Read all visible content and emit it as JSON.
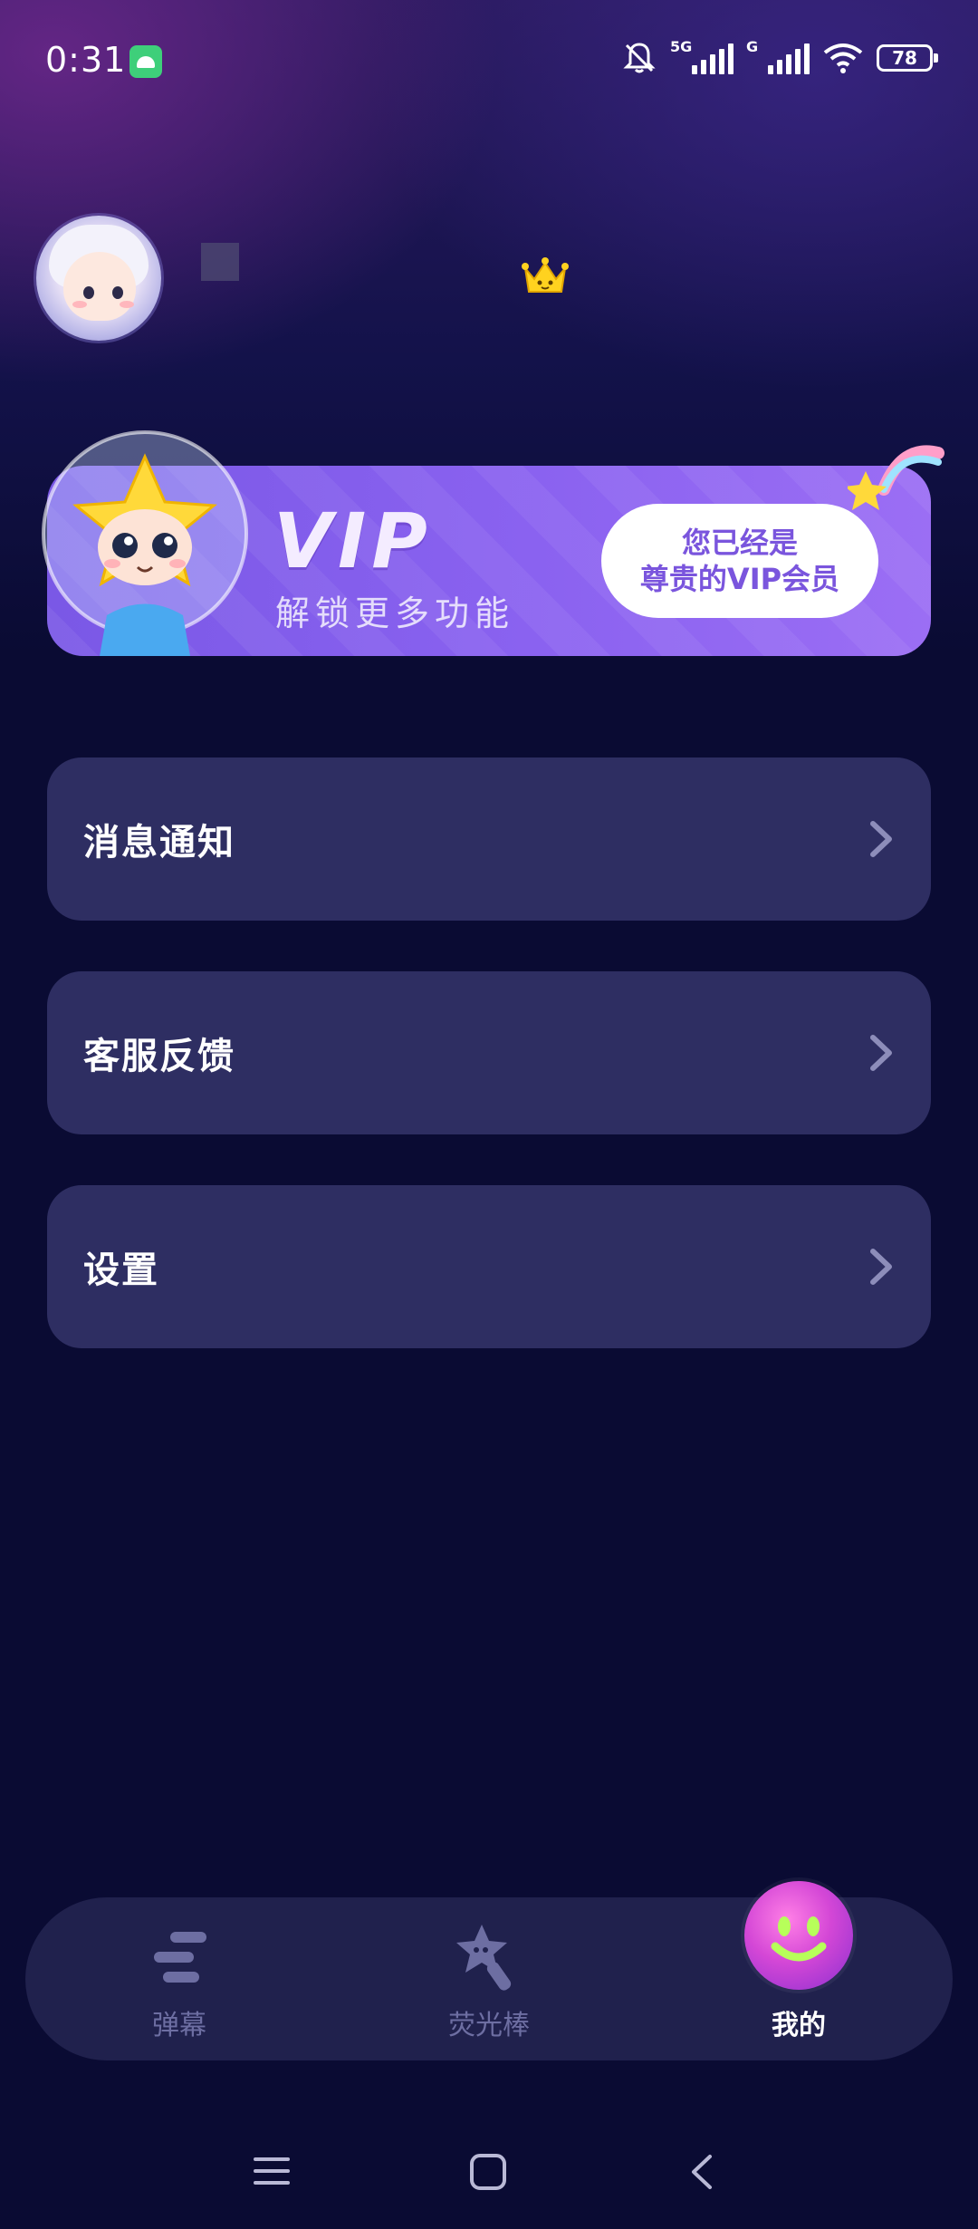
{
  "status_bar": {
    "time": "0:31",
    "network_tag_1": "5G",
    "network_tag_2": "G",
    "battery": "78"
  },
  "profile": {
    "crown_icon": "crown-icon"
  },
  "vip_banner": {
    "title": "VIP",
    "subtitle": "解锁更多功能",
    "button_line1": "您已经是",
    "button_line2": "尊贵的VIP会员"
  },
  "menu": [
    {
      "label": "消息通知"
    },
    {
      "label": "客服反馈"
    },
    {
      "label": "设置"
    }
  ],
  "tabs": [
    {
      "label": "弹幕",
      "icon": "danmu-icon"
    },
    {
      "label": "荧光棒",
      "icon": "star-wand-icon"
    },
    {
      "label": "我的",
      "icon": "smile-face-icon"
    }
  ],
  "colors": {
    "background": "#0a0b33",
    "card": "#2e2e62",
    "vip_purple": "#8a62f0",
    "tab_inactive": "#6d6ea2"
  }
}
